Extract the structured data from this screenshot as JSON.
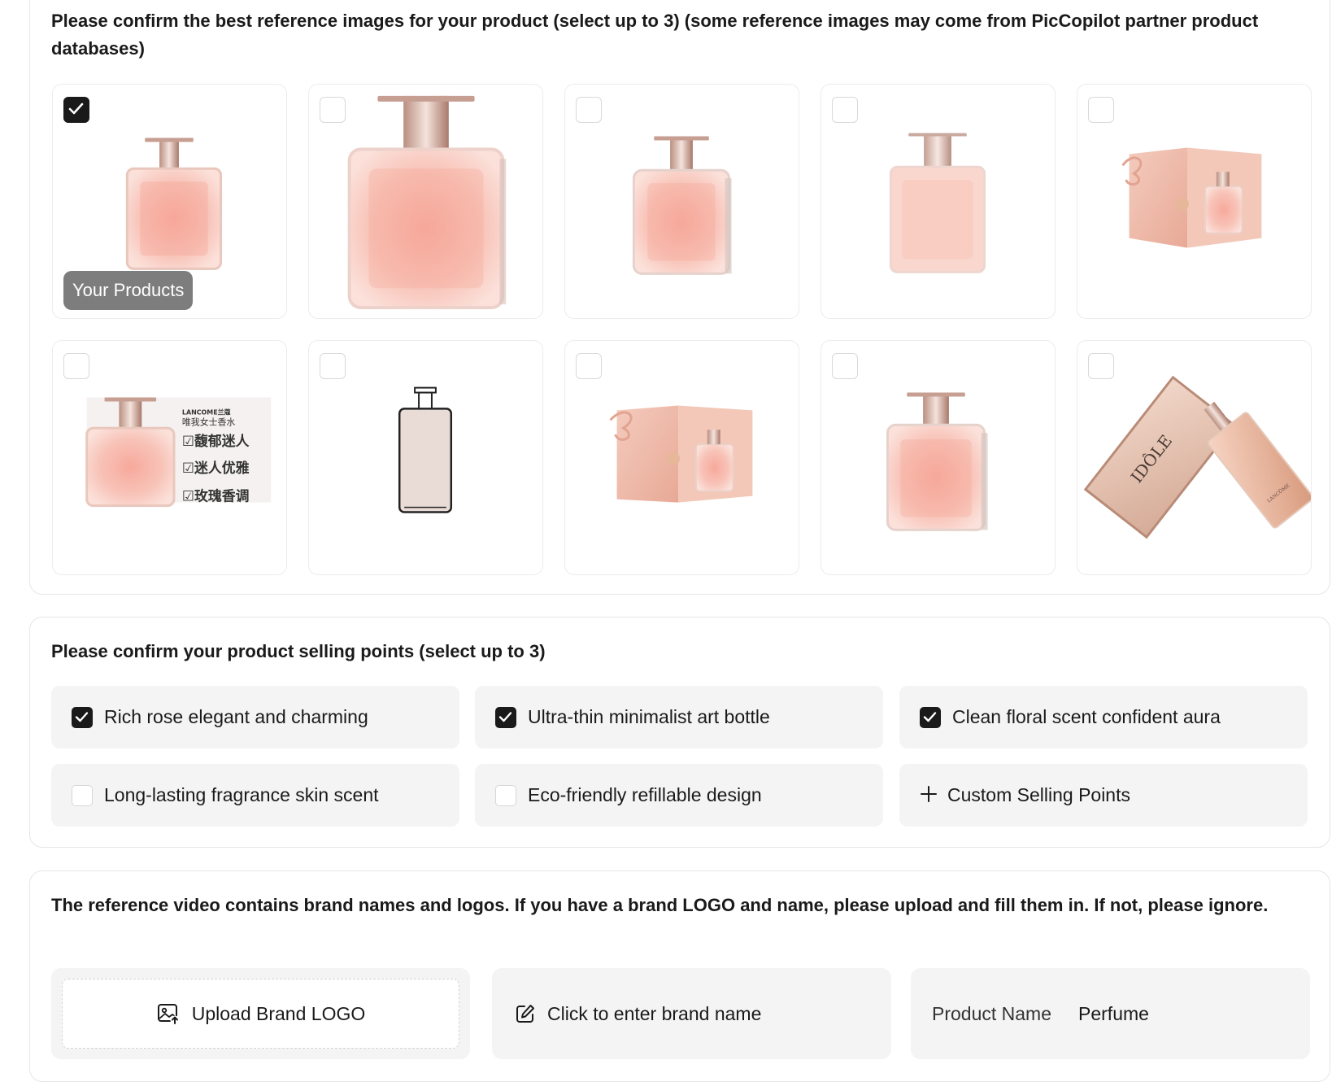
{
  "reference": {
    "heading": "Please confirm the best reference images for your product (select up to 3) (some reference images may come from PicCopilot partner product databases)",
    "badge": "Your Products",
    "images": [
      {
        "icon": "perfume-bottle-icon",
        "selected": true
      },
      {
        "icon": "perfume-bottle-large-icon",
        "selected": false
      },
      {
        "icon": "perfume-bottle-icon",
        "selected": false
      },
      {
        "icon": "perfume-bottle-light-icon",
        "selected": false
      },
      {
        "icon": "perfume-gift-box-icon",
        "selected": false
      },
      {
        "icon": "perfume-with-chinese-text-icon",
        "selected": false,
        "overlay_text": [
          "LANCOME兰蔻",
          "唯我女士香水",
          "馥郁迷人",
          "迷人优雅",
          "玫瑰香调"
        ]
      },
      {
        "icon": "bottle-outline-icon",
        "selected": false
      },
      {
        "icon": "perfume-gift-box-icon",
        "selected": false
      },
      {
        "icon": "perfume-bottle-icon",
        "selected": false
      },
      {
        "icon": "idole-box-and-bottle-icon",
        "selected": false,
        "overlay_text": [
          "IDÔLE",
          "LANCÔME"
        ]
      }
    ]
  },
  "selling_points": {
    "heading": "Please confirm your product selling points (select up to 3)",
    "items": [
      {
        "label": "Rich rose elegant and charming",
        "checked": true
      },
      {
        "label": "Ultra-thin minimalist art bottle",
        "checked": true
      },
      {
        "label": "Clean floral scent confident aura",
        "checked": true
      },
      {
        "label": "Long-lasting fragrance skin scent",
        "checked": false
      },
      {
        "label": "Eco-friendly refillable design",
        "checked": false
      }
    ],
    "custom_label": "Custom Selling Points"
  },
  "brand": {
    "heading": "The reference video contains brand names and logos. If you have a brand LOGO and name, please upload and fill them in. If not, please ignore.",
    "upload_label": "Upload Brand LOGO",
    "name_placeholder": "Click to enter brand name",
    "product_name_label": "Product Name",
    "product_name_value": "Perfume"
  },
  "colors": {
    "checked": "#1a1a1a",
    "tile_bg": "#f4f4f4",
    "badge": "#7d7d7d",
    "perfume_pink": "#f6b9ad"
  }
}
